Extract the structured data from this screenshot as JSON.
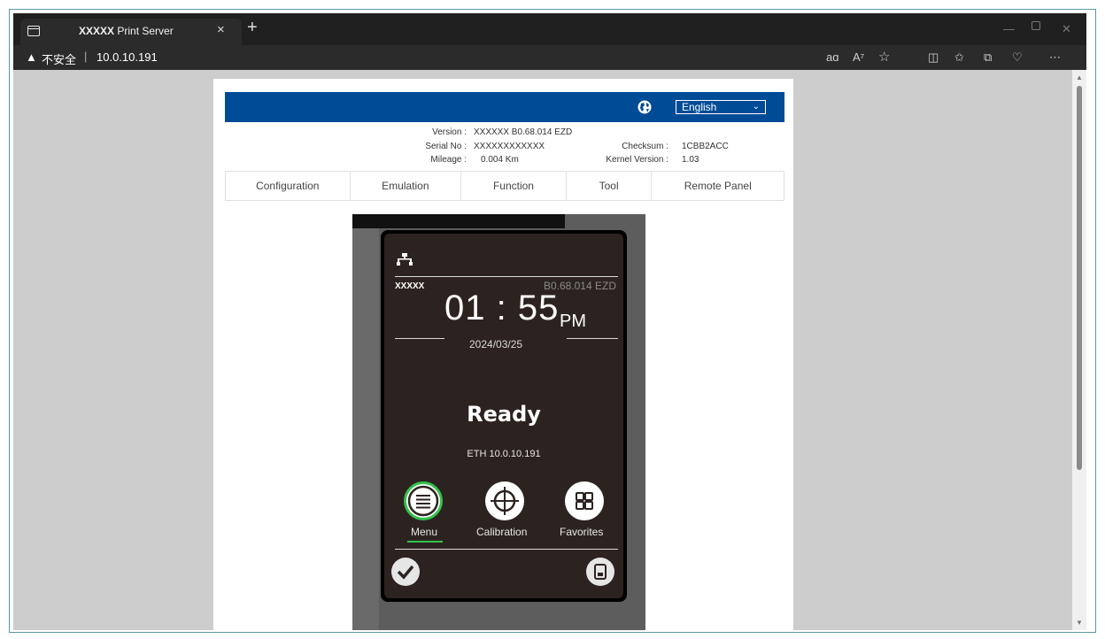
{
  "browser": {
    "tab_title_bold": "XXXXX",
    "tab_title_rest": " Print Server",
    "tab_close": "×",
    "new_tab": "+",
    "security_label": "不安全",
    "separator": "|",
    "url": "10.0.10.191",
    "toolbar_icons": [
      "read-aloud-translate-icon",
      "read-aloud-icon",
      "favorite-star-icon",
      "split-screen-icon",
      "favorites-icon",
      "collections-icon",
      "browser-essentials-icon",
      "more-icon"
    ],
    "win_controls": [
      "minimize-icon",
      "maximize-icon",
      "close-icon"
    ]
  },
  "header": {
    "language": "English"
  },
  "info": {
    "version_label": "Version :",
    "version_value": "XXXXXX  B0.68.014 EZD",
    "serial_label": "Serial No :",
    "serial_value": "XXXXXXXXXXXX",
    "mileage_label": "Mileage :",
    "mileage_value": "0.004 Km",
    "checksum_label": "Checksum :",
    "checksum_value": "1CBB2ACC",
    "kernel_label": "Kernel Version :",
    "kernel_value": "1.03"
  },
  "nav": [
    "Configuration",
    "Emulation",
    "Function",
    "Tool",
    "Remote Panel"
  ],
  "panel": {
    "model": "XXXXX",
    "firmware": "B0.68.014  EZD",
    "time": "01 : 55",
    "ampm": "PM",
    "date": "2024/03/25",
    "status": "Ready",
    "ip": "ETH 10.0.10.191",
    "buttons": [
      "Menu",
      "Calibration",
      "Favorites"
    ]
  },
  "colors": {
    "header_blue": "#004b96",
    "menu_green": "#33c24a",
    "lcd_bg": "#2c2321"
  }
}
